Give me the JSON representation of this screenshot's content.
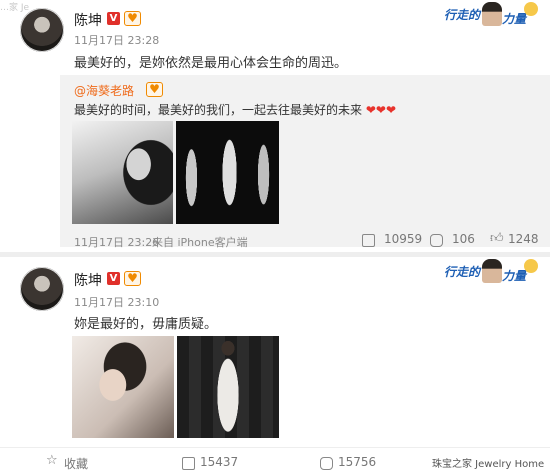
{
  "watermark_top": "…家 Je",
  "post1": {
    "author": "陈坤",
    "time": "11月17日 23:28",
    "text": "最美好的，是妳依然是最用心体会生命的周迅。",
    "promo_left": "行走的",
    "promo_right": "力量",
    "repost": {
      "author": "@海葵老路",
      "text": "最美好的时间，最美好的我们，一起去往最美好的未来",
      "time": "11月17日 23:26",
      "source": "来自 iPhone客户端",
      "reposts": "10959",
      "comments": "106",
      "likes": "1248"
    }
  },
  "post2": {
    "author": "陈坤",
    "time": "11月17日 23:10",
    "text": "妳是最好的，毋庸质疑。",
    "promo_left": "行走的",
    "promo_right": "力量",
    "favorite_label": "收藏",
    "reposts": "15437",
    "comments": "15756",
    "watermark": "珠宝之家 Jewelry Home"
  },
  "colors": {
    "accent_orange": "#ef6b1b",
    "verified_red": "#e0302a",
    "promo_blue": "#1e5fb4",
    "repost_bg": "#f2f2f2"
  }
}
